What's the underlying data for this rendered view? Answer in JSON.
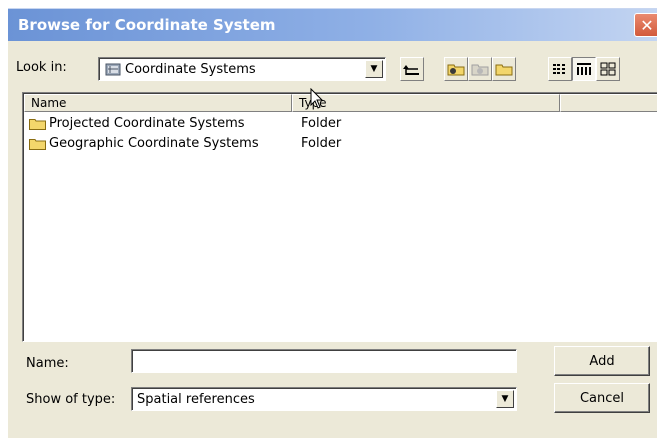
{
  "window": {
    "title": "Browse for Coordinate System",
    "close_label": "✕"
  },
  "toolbar": {
    "look_in_label": "Look in:",
    "look_in_value": "Coordinate Systems",
    "buttons": [
      {
        "name": "up-one-level",
        "icon": "up-folder-icon"
      },
      {
        "name": "connect-to-folder",
        "icon": "connect-folder-icon"
      },
      {
        "name": "disconnect-folder",
        "icon": "disconnect-folder-icon"
      },
      {
        "name": "new-folder",
        "icon": "new-folder-icon"
      },
      {
        "name": "list-view",
        "icon": "list-view-icon"
      },
      {
        "name": "details-view",
        "icon": "details-view-icon"
      },
      {
        "name": "thumbnails-view",
        "icon": "thumbnails-view-icon"
      }
    ]
  },
  "list": {
    "columns": [
      "Name",
      "Type"
    ],
    "rows": [
      {
        "name": "Projected Coordinate Systems",
        "type": "Folder"
      },
      {
        "name": "Geographic Coordinate Systems",
        "type": "Folder"
      }
    ]
  },
  "footer": {
    "name_label": "Name:",
    "name_value": "",
    "type_label": "Show of type:",
    "type_value": "Spatial references",
    "add_label": "Add",
    "cancel_label": "Cancel"
  },
  "colors": {
    "title_gradient_start": "#6b93d6",
    "close_button": "#d25a3c",
    "dialog_bg": "#ece9d8",
    "folder_yellow": "#f3d66b"
  }
}
